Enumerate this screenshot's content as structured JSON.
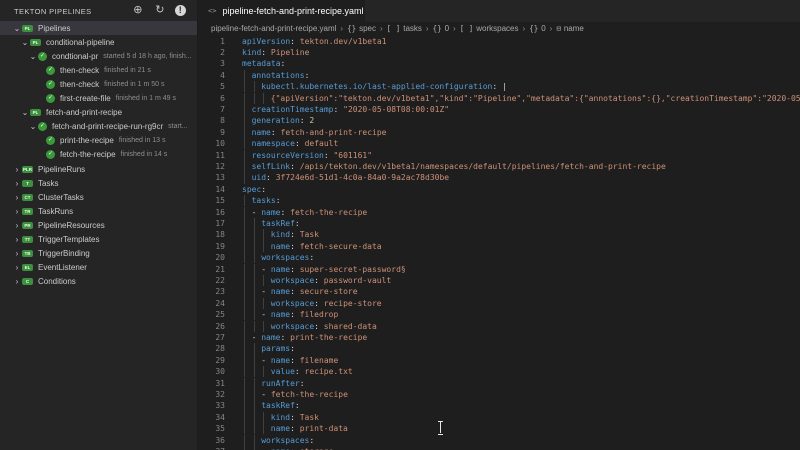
{
  "sidebar": {
    "title": "TEKTON PIPELINES",
    "icons": [
      "add-trigger-icon",
      "refresh-icon",
      "info-icon"
    ],
    "tree": [
      {
        "label": "Pipelines",
        "badge": "PL",
        "expanded": true,
        "desc": ""
      },
      {
        "label": "conditional-pipeline",
        "badge": "PL",
        "expanded": true,
        "desc": ""
      },
      {
        "label": "condtional-pr",
        "badge": "",
        "expanded": true,
        "desc": "started 5 d 18 h ago, finish..."
      },
      {
        "label": "then-check",
        "badge": "",
        "expanded": false,
        "desc": "finished in 21 s"
      },
      {
        "label": "then-check",
        "badge": "",
        "expanded": false,
        "desc": "finished in 1 m 50 s"
      },
      {
        "label": "first-create-file",
        "badge": "",
        "expanded": false,
        "desc": "finished in 1 m 49 s"
      },
      {
        "label": "fetch-and-print-recipe",
        "badge": "PL",
        "expanded": true,
        "desc": ""
      },
      {
        "label": "fetch-and-print-recipe-run-rg9cr",
        "badge": "",
        "expanded": true,
        "desc": "start..."
      },
      {
        "label": "print-the-recipe",
        "badge": "",
        "expanded": false,
        "desc": "finished in 13 s"
      },
      {
        "label": "fetch-the-recipe",
        "badge": "",
        "expanded": false,
        "desc": "finished in 14 s"
      },
      {
        "label": "PipelineRuns",
        "badge": "PLR",
        "expanded": false,
        "desc": ""
      },
      {
        "label": "Tasks",
        "badge": "T",
        "expanded": false,
        "desc": ""
      },
      {
        "label": "ClusterTasks",
        "badge": "CT",
        "expanded": false,
        "desc": ""
      },
      {
        "label": "TaskRuns",
        "badge": "TR",
        "expanded": false,
        "desc": ""
      },
      {
        "label": "PipelineResources",
        "badge": "PR",
        "expanded": false,
        "desc": ""
      },
      {
        "label": "TriggerTemplates",
        "badge": "TT",
        "expanded": false,
        "desc": ""
      },
      {
        "label": "TriggerBinding",
        "badge": "TB",
        "expanded": false,
        "desc": ""
      },
      {
        "label": "EventListener",
        "badge": "EL",
        "expanded": false,
        "desc": ""
      },
      {
        "label": "Conditions",
        "badge": "C",
        "expanded": false,
        "desc": ""
      }
    ]
  },
  "tab": {
    "icon": "<>",
    "label": "pipeline-fetch-and-print-recipe.yaml"
  },
  "breadcrumb": [
    {
      "sym": "",
      "label": "pipeline-fetch-and-print-recipe.yaml"
    },
    {
      "sym": "{}",
      "label": "spec"
    },
    {
      "sym": "[ ]",
      "label": "tasks"
    },
    {
      "sym": "{}",
      "label": "0"
    },
    {
      "sym": "[ ]",
      "label": "workspaces"
    },
    {
      "sym": "{}",
      "label": "0"
    },
    {
      "sym": "⊟",
      "label": "name"
    }
  ],
  "editor": {
    "lines": [
      {
        "n": "1",
        "indent": 0,
        "key": "apiVersion",
        "val": "tekton.dev/v1beta1",
        "dash": false,
        "vt": "v"
      },
      {
        "n": "2",
        "indent": 0,
        "key": "kind",
        "val": "Pipeline",
        "dash": false,
        "vt": "v"
      },
      {
        "n": "3",
        "indent": 0,
        "key": "metadata",
        "val": "",
        "dash": false,
        "vt": "v"
      },
      {
        "n": "4",
        "indent": 1,
        "key": "annotations",
        "val": "",
        "dash": false,
        "vt": "v"
      },
      {
        "n": "5",
        "indent": 2,
        "key": "kubectl.kubernetes.io/last-applied-configuration",
        "val": "|",
        "dash": false,
        "vt": "p"
      },
      {
        "n": "6",
        "indent": 3,
        "key": "",
        "val": "{\"apiVersion\":\"tekton.dev/v1beta1\",\"kind\":\"Pipeline\",\"metadata\":{\"annotations\":{},\"creationTimestamp\":\"2020-05-08T08:00",
        "dash": false,
        "vt": "v"
      },
      {
        "n": "7",
        "indent": 1,
        "key": "creationTimestamp",
        "val": "\"2020-05-08T08:00:01Z\"",
        "dash": false,
        "vt": "v"
      },
      {
        "n": "8",
        "indent": 1,
        "key": "generation",
        "val": "2",
        "dash": false,
        "vt": "n"
      },
      {
        "n": "9",
        "indent": 1,
        "key": "name",
        "val": "fetch-and-print-recipe",
        "dash": false,
        "vt": "v"
      },
      {
        "n": "10",
        "indent": 1,
        "key": "namespace",
        "val": "default",
        "dash": false,
        "vt": "v"
      },
      {
        "n": "11",
        "indent": 1,
        "key": "resourceVersion",
        "val": "\"601161\"",
        "dash": false,
        "vt": "v"
      },
      {
        "n": "12",
        "indent": 1,
        "key": "selfLink",
        "val": "/apis/tekton.dev/v1beta1/namespaces/default/pipelines/fetch-and-print-recipe",
        "dash": false,
        "vt": "v"
      },
      {
        "n": "13",
        "indent": 1,
        "key": "uid",
        "val": "3f724e6d-51d1-4c0a-84a0-9a2ac78d30be",
        "dash": false,
        "vt": "v"
      },
      {
        "n": "14",
        "indent": 0,
        "key": "spec",
        "val": "",
        "dash": false,
        "vt": "v"
      },
      {
        "n": "15",
        "indent": 1,
        "key": "tasks",
        "val": "",
        "dash": false,
        "vt": "v"
      },
      {
        "n": "16",
        "indent": 1,
        "key": "name",
        "val": "fetch-the-recipe",
        "dash": true,
        "vt": "v"
      },
      {
        "n": "17",
        "indent": 2,
        "key": "taskRef",
        "val": "",
        "dash": false,
        "vt": "v"
      },
      {
        "n": "18",
        "indent": 3,
        "key": "kind",
        "val": "Task",
        "dash": false,
        "vt": "v"
      },
      {
        "n": "19",
        "indent": 3,
        "key": "name",
        "val": "fetch-secure-data",
        "dash": false,
        "vt": "v"
      },
      {
        "n": "20",
        "indent": 2,
        "key": "workspaces",
        "val": "",
        "dash": false,
        "vt": "v"
      },
      {
        "n": "21",
        "indent": 2,
        "key": "name",
        "val": "super-secret-password§",
        "dash": true,
        "vt": "v"
      },
      {
        "n": "22",
        "indent": 3,
        "key": "workspace",
        "val": "password-vault",
        "dash": false,
        "vt": "v"
      },
      {
        "n": "23",
        "indent": 2,
        "key": "name",
        "val": "secure-store",
        "dash": true,
        "vt": "v"
      },
      {
        "n": "24",
        "indent": 3,
        "key": "workspace",
        "val": "recipe-store",
        "dash": false,
        "vt": "v"
      },
      {
        "n": "25",
        "indent": 2,
        "key": "name",
        "val": "filedrop",
        "dash": true,
        "vt": "v"
      },
      {
        "n": "26",
        "indent": 3,
        "key": "workspace",
        "val": "shared-data",
        "dash": false,
        "vt": "v"
      },
      {
        "n": "27",
        "indent": 1,
        "key": "name",
        "val": "print-the-recipe",
        "dash": true,
        "vt": "v"
      },
      {
        "n": "28",
        "indent": 2,
        "key": "params",
        "val": "",
        "dash": false,
        "vt": "v"
      },
      {
        "n": "29",
        "indent": 2,
        "key": "name",
        "val": "filename",
        "dash": true,
        "vt": "v"
      },
      {
        "n": "30",
        "indent": 3,
        "key": "value",
        "val": "recipe.txt",
        "dash": false,
        "vt": "v"
      },
      {
        "n": "31",
        "indent": 2,
        "key": "runAfter",
        "val": "",
        "dash": false,
        "vt": "v"
      },
      {
        "n": "32",
        "indent": 2,
        "key": "",
        "val": "fetch-the-recipe",
        "dash": true,
        "vt": "v"
      },
      {
        "n": "33",
        "indent": 2,
        "key": "taskRef",
        "val": "",
        "dash": false,
        "vt": "v"
      },
      {
        "n": "34",
        "indent": 3,
        "key": "kind",
        "val": "Task",
        "dash": false,
        "vt": "v"
      },
      {
        "n": "35",
        "indent": 3,
        "key": "name",
        "val": "print-data",
        "dash": false,
        "vt": "v"
      },
      {
        "n": "36",
        "indent": 2,
        "key": "workspaces",
        "val": "",
        "dash": false,
        "vt": "v"
      },
      {
        "n": "37",
        "indent": 2,
        "key": "name",
        "val": "storage",
        "dash": true,
        "vt": "v"
      }
    ]
  }
}
